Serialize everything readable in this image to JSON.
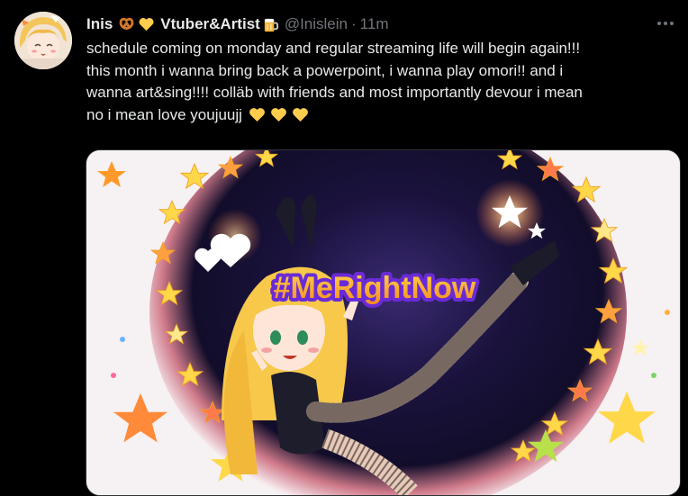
{
  "tweet": {
    "display_name": "Inis",
    "name_suffix": "Vtuber&Artist",
    "handle": "@Inislein",
    "separator": "·",
    "time": "11m",
    "text_lines": [
      "schedule coming on monday and regular streaming life will begin again!!!",
      "this month i wanna bring back a powerpoint, i wanna play omori!! and i",
      "wanna art&sing!!!! colläb with friends and most importantly devour i mean",
      "no i mean love youjuujj"
    ],
    "emoji": [
      "pretzel-emoji",
      "yellow-heart-emoji",
      "beer-mug-emoji"
    ],
    "trailing_hearts": [
      "yellow-heart-emoji",
      "yellow-heart-emoji",
      "yellow-heart-emoji"
    ]
  },
  "media": {
    "hashtag": "#MeRightNow",
    "description_icon": "anime-character-illustration"
  },
  "colors": {
    "background": "#000000",
    "primary_text": "#e7e9ea",
    "secondary_text": "#71767b",
    "heart_yellow": "#ffcc4d",
    "hashtag_orange": "#f5a623",
    "hashtag_purple": "#6a2bd6"
  }
}
